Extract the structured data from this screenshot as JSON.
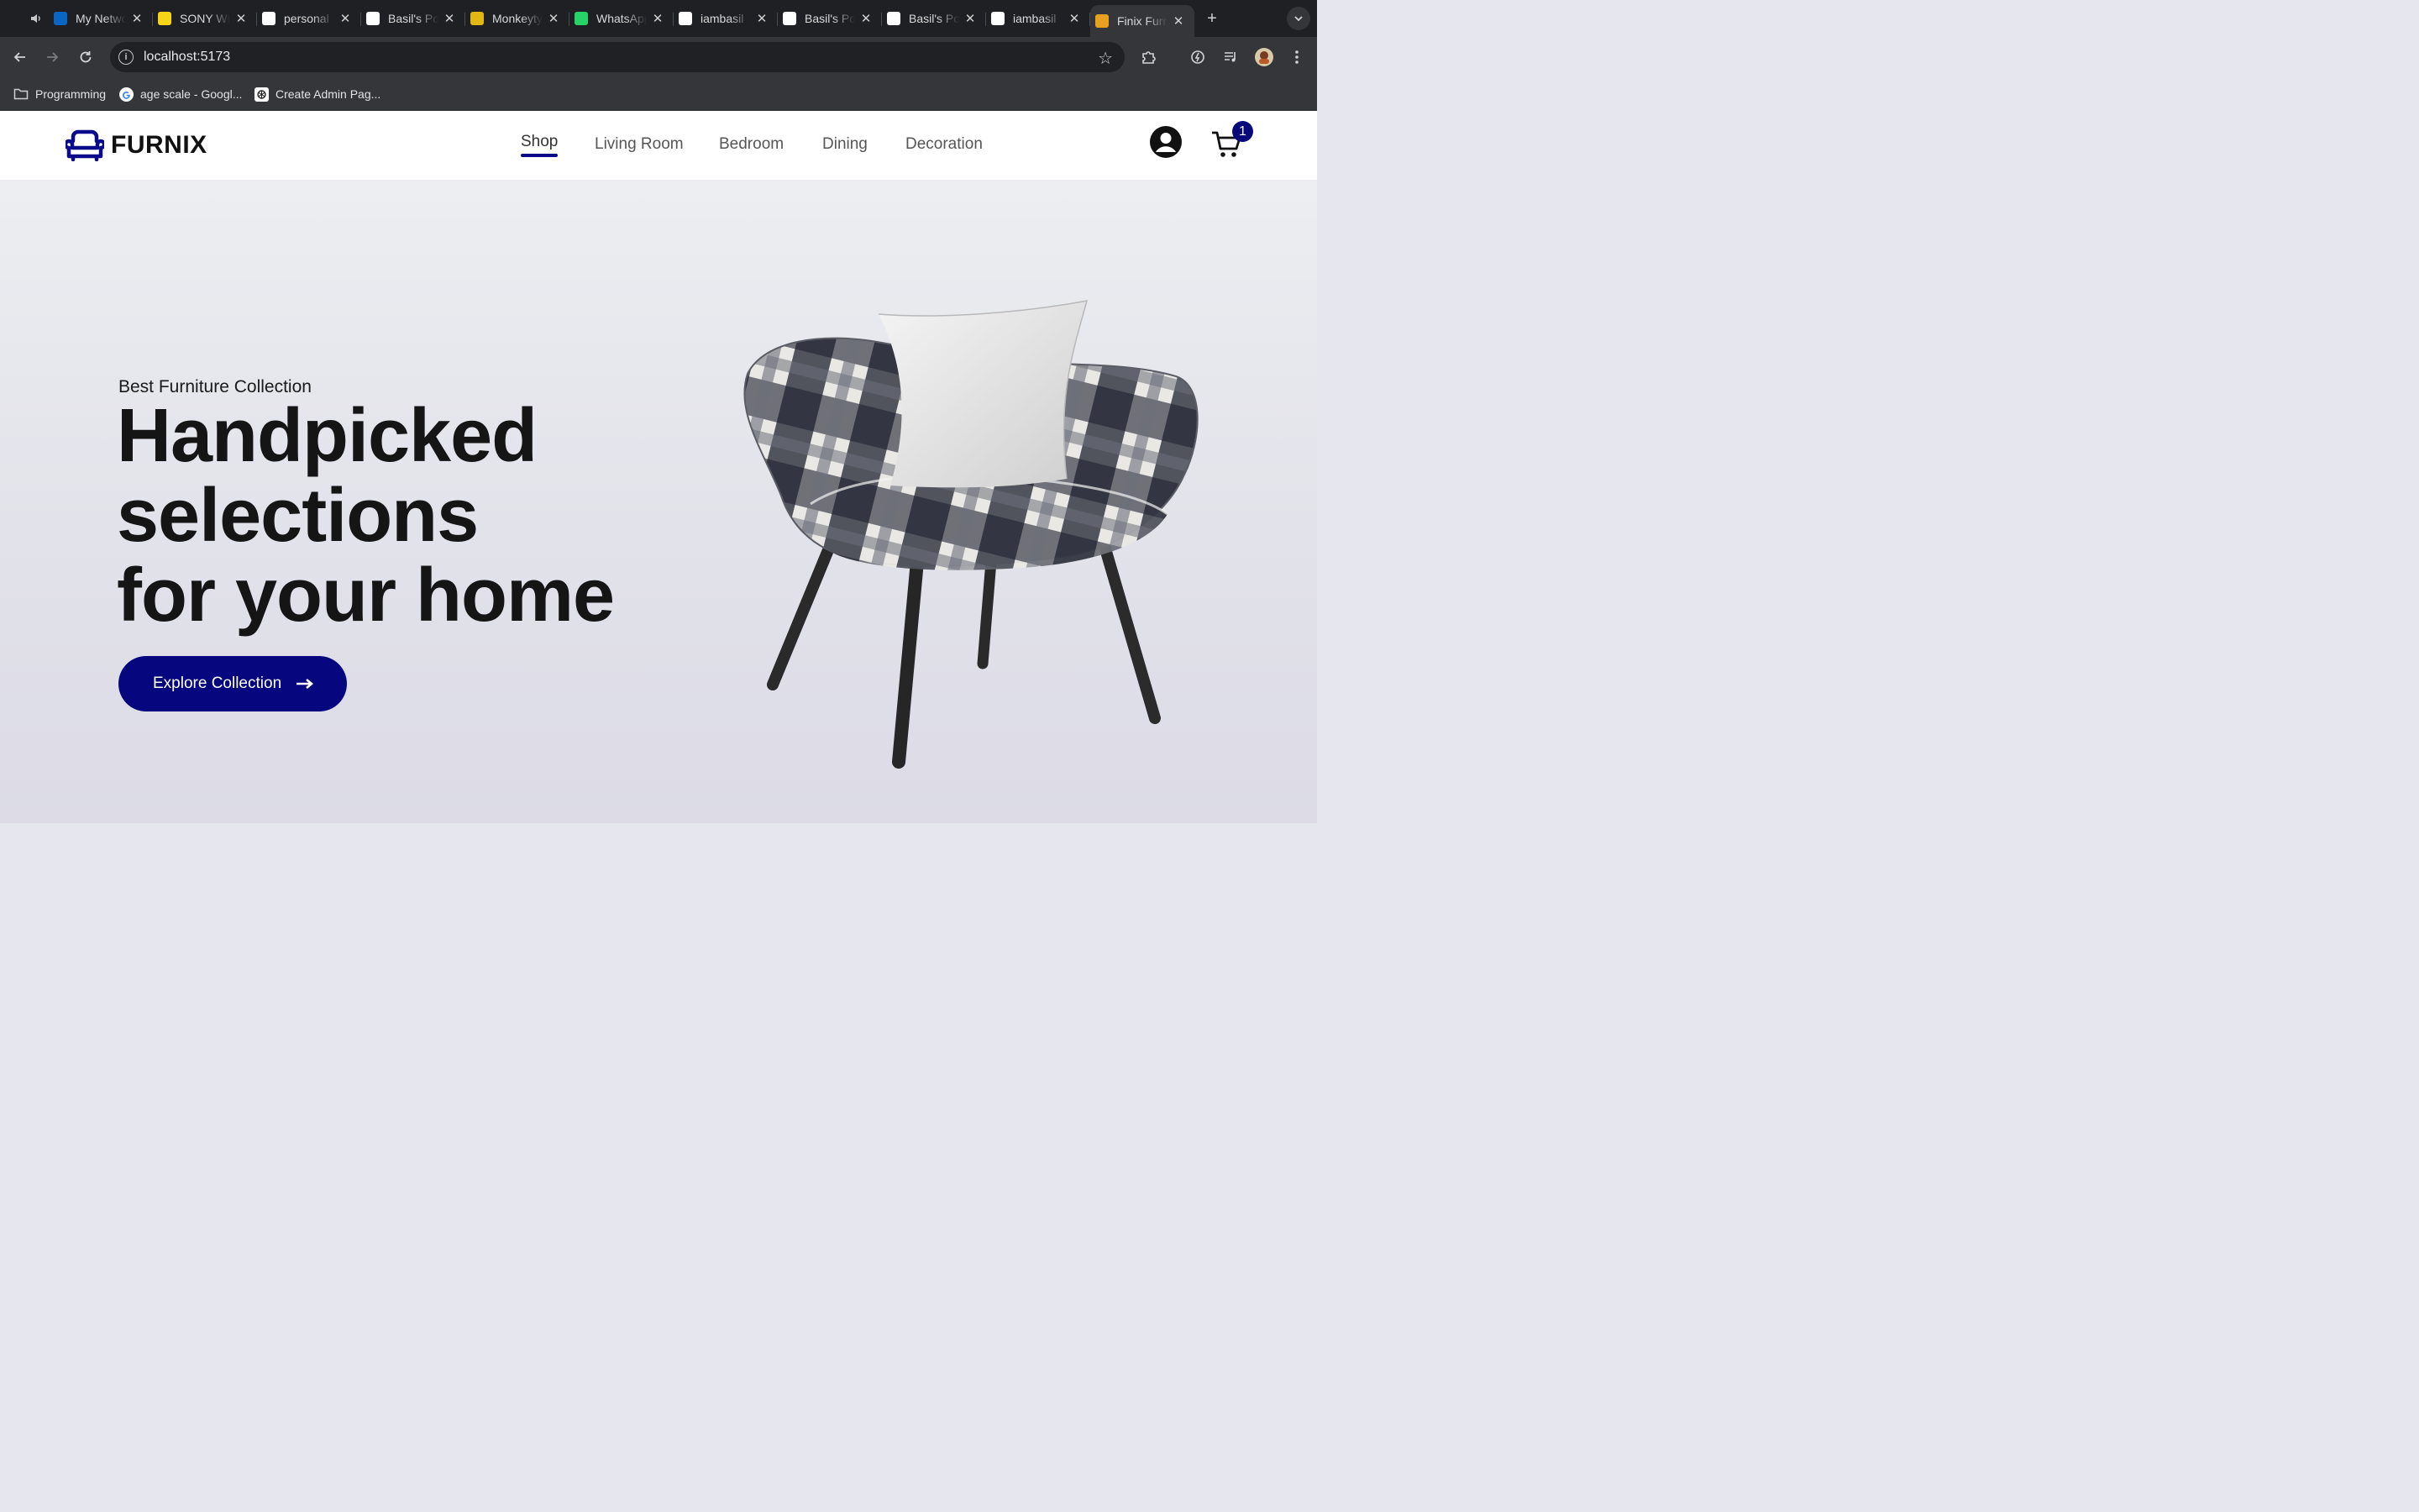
{
  "browser": {
    "tabs": [
      {
        "title": "My Network",
        "icon": "linkedin-icon",
        "color": "#0a66c2"
      },
      {
        "title": "SONY WH",
        "icon": "flipkart-icon",
        "color": "#f7d417"
      },
      {
        "title": "personal",
        "icon": "vercel-icon",
        "color": "#ffffff"
      },
      {
        "title": "Basil's Portfolio",
        "icon": "bas-icon",
        "color": "#ffffff"
      },
      {
        "title": "Monkeytype",
        "icon": "monkeytype-icon",
        "color": "#e2b714"
      },
      {
        "title": "WhatsApp",
        "icon": "whatsapp-icon",
        "color": "#25d366"
      },
      {
        "title": "iambasil",
        "icon": "github-icon",
        "color": "#ffffff"
      },
      {
        "title": "Basil's Portfolio",
        "icon": "bas-icon",
        "color": "#ffffff"
      },
      {
        "title": "Basil's Portfolio",
        "icon": "bas-icon",
        "color": "#ffffff"
      },
      {
        "title": "iambasil",
        "icon": "github-icon",
        "color": "#ffffff"
      },
      {
        "title": "Finix Furniture",
        "icon": "sofa-icon",
        "color": "#e8a020",
        "active": true
      }
    ],
    "url": "localhost:5173",
    "bookmarks": [
      {
        "label": "Programming",
        "icon": "folder-icon"
      },
      {
        "label": "age scale - Googl...",
        "icon": "google-icon"
      },
      {
        "label": "Create Admin Pag...",
        "icon": "openai-icon"
      }
    ]
  },
  "site": {
    "brand": "FURNIX",
    "nav": [
      "Shop",
      "Living Room",
      "Bedroom",
      "Dining",
      "Decoration"
    ],
    "active_nav": "Shop",
    "cart_count": "1",
    "accent_color": "#06067e"
  },
  "hero": {
    "kicker": "Best Furniture Collection",
    "headline": [
      "Handpicked",
      "selections",
      "for your home"
    ],
    "cta": "Explore Collection"
  }
}
